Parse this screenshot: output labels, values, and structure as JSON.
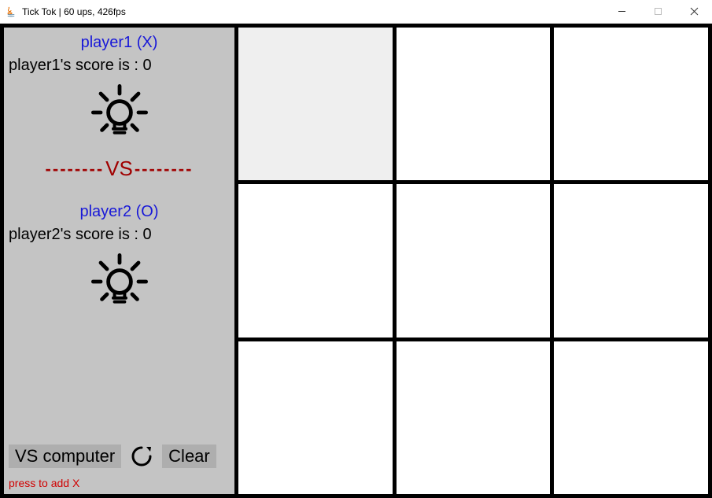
{
  "window": {
    "title": "Tick Tok  |  60 ups, 426fps"
  },
  "sidebar": {
    "player1": {
      "label": "player1 (X)",
      "score_text": "player1's score is : 0",
      "hint_icon": "lightbulb-icon"
    },
    "vs_label": "VS",
    "player2": {
      "label": "player2 (O)",
      "score_text": "player2's score is : 0",
      "hint_icon": "lightbulb-icon"
    },
    "controls": {
      "vs_computer_label": "VS computer",
      "refresh_icon": "refresh-icon",
      "clear_label": "Clear"
    },
    "hint_text": "press to add X"
  },
  "board": {
    "cells": [
      {
        "value": "",
        "highlight": true
      },
      {
        "value": "",
        "highlight": false
      },
      {
        "value": "",
        "highlight": false
      },
      {
        "value": "",
        "highlight": false
      },
      {
        "value": "",
        "highlight": false
      },
      {
        "value": "",
        "highlight": false
      },
      {
        "value": "",
        "highlight": false
      },
      {
        "value": "",
        "highlight": false
      },
      {
        "value": "",
        "highlight": false
      }
    ]
  },
  "colors": {
    "accent_blue": "#1818d8",
    "accent_red": "#a00000",
    "sidebar_bg": "#c4c4c4",
    "button_bg": "#aeaeae"
  }
}
